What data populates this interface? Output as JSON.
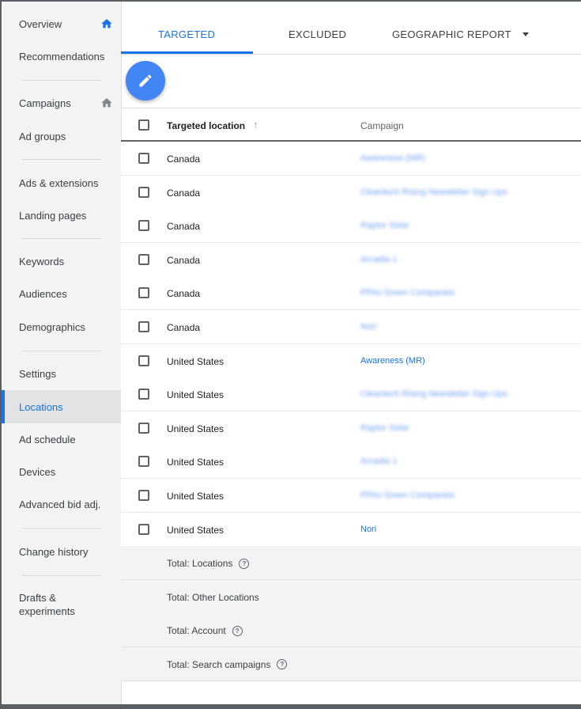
{
  "sidebar": {
    "items": [
      {
        "label": "Overview",
        "icon": "home-icon",
        "active": false
      },
      {
        "label": "Recommendations",
        "active": false
      },
      {
        "label": "Campaigns",
        "icon": "home-icon",
        "active": false
      },
      {
        "label": "Ad groups",
        "active": false
      },
      {
        "label": "Ads & extensions",
        "active": false
      },
      {
        "label": "Landing pages",
        "active": false
      },
      {
        "label": "Keywords",
        "active": false
      },
      {
        "label": "Audiences",
        "active": false
      },
      {
        "label": "Demographics",
        "active": false
      },
      {
        "label": "Settings",
        "active": false
      },
      {
        "label": "Locations",
        "active": true
      },
      {
        "label": "Ad schedule",
        "active": false
      },
      {
        "label": "Devices",
        "active": false
      },
      {
        "label": "Advanced bid adj.",
        "active": false
      },
      {
        "label": "Change history",
        "active": false
      },
      {
        "label": "Drafts & experiments",
        "active": false
      }
    ]
  },
  "tabs": [
    {
      "label": "TARGETED",
      "active": true
    },
    {
      "label": "EXCLUDED",
      "active": false
    },
    {
      "label": "GEOGRAPHIC REPORT",
      "active": false,
      "dropdown": true
    }
  ],
  "fab": {
    "icon": "pencil-icon"
  },
  "table": {
    "columns": {
      "location": "Targeted location",
      "campaign": "Campaign"
    },
    "sort_icon": "arrow-up-icon",
    "rows": [
      {
        "location": "Canada",
        "campaign": "Awareness (MR)",
        "blurred": true
      },
      {
        "location": "Canada",
        "campaign": "Cleantech Rising Newsletter Sign Ups",
        "blurred": true
      },
      {
        "location": "Canada",
        "campaign": "Raptor Solar",
        "blurred": true
      },
      {
        "location": "Canada",
        "campaign": "Arcadia 1",
        "blurred": true
      },
      {
        "location": "Canada",
        "campaign": "PPAs Green Companies",
        "blurred": true
      },
      {
        "location": "Canada",
        "campaign": "Nori",
        "blurred": true
      },
      {
        "location": "United States",
        "campaign": "Awareness (MR)",
        "blurred": false
      },
      {
        "location": "United States",
        "campaign": "Cleantech Rising Newsletter Sign Ups",
        "blurred": true
      },
      {
        "location": "United States",
        "campaign": "Raptor Solar",
        "blurred": true
      },
      {
        "location": "United States",
        "campaign": "Arcadia 1",
        "blurred": true
      },
      {
        "location": "United States",
        "campaign": "PPAs Green Companies",
        "blurred": true
      },
      {
        "location": "United States",
        "campaign": "Nori",
        "blurred": false
      }
    ],
    "totals": [
      {
        "label": "Total: Locations",
        "help": true
      },
      {
        "label": "Total: Other Locations",
        "help": false
      },
      {
        "label": "Total: Account",
        "help": true
      },
      {
        "label": "Total: Search campaigns",
        "help": true
      }
    ],
    "help_glyph": "?"
  },
  "colors": {
    "accent": "#1a73e8",
    "fab": "#4285f4",
    "sidebar_bg": "#f1f3f4"
  }
}
